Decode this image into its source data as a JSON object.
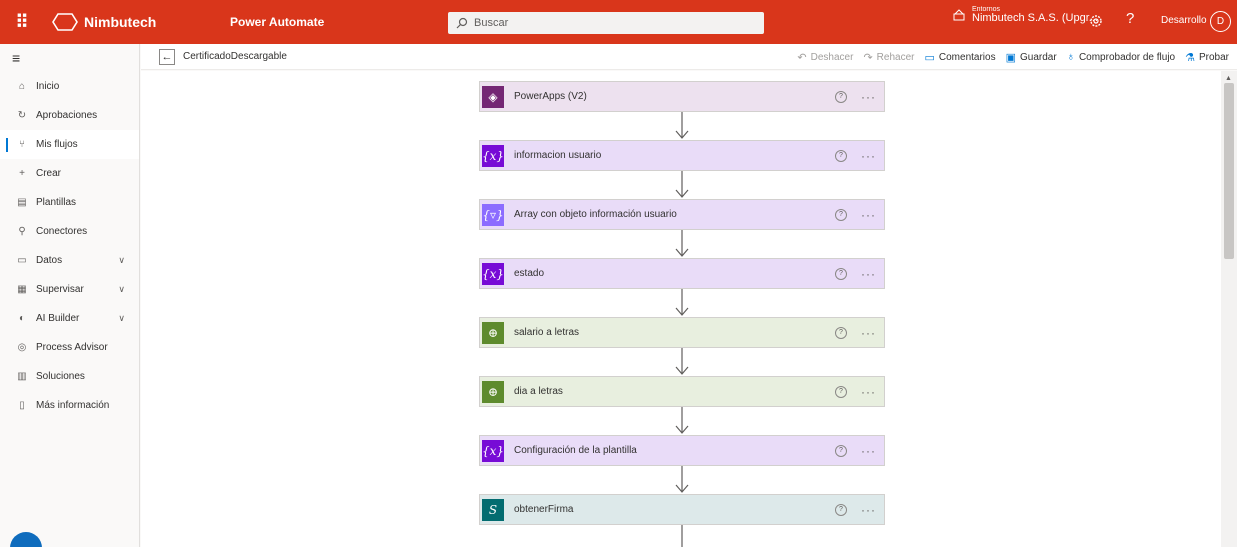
{
  "topbar": {
    "brand": "Nimbutech",
    "app": "Power Automate",
    "search_placeholder": "Buscar",
    "env_label": "Entornos",
    "env_name": "Nimbutech S.A.S. (Upgr...",
    "help": "?",
    "user": "Desarrollo",
    "avatar": "D"
  },
  "nav": {
    "items": [
      {
        "label": "Inicio",
        "icon": "home-icon"
      },
      {
        "label": "Aprobaciones",
        "icon": "approvals-icon"
      },
      {
        "label": "Mis flujos",
        "icon": "flows-icon",
        "active": true
      },
      {
        "label": "Crear",
        "icon": "plus-icon"
      },
      {
        "label": "Plantillas",
        "icon": "templates-icon"
      },
      {
        "label": "Conectores",
        "icon": "connectors-icon"
      },
      {
        "label": "Datos",
        "icon": "data-icon",
        "chevron": true
      },
      {
        "label": "Supervisar",
        "icon": "monitor-icon",
        "chevron": true
      },
      {
        "label": "AI Builder",
        "icon": "ai-builder-icon",
        "chevron": true
      },
      {
        "label": "Process Advisor",
        "icon": "process-advisor-icon"
      },
      {
        "label": "Soluciones",
        "icon": "solutions-icon"
      },
      {
        "label": "Más información",
        "icon": "book-icon"
      }
    ]
  },
  "cmdbar": {
    "flow_name": "CertificadoDescargable",
    "undo": "Deshacer",
    "redo": "Rehacer",
    "comments": "Comentarios",
    "save": "Guardar",
    "checker": "Comprobador de flujo",
    "test": "Probar"
  },
  "flow": {
    "steps": [
      {
        "title": "PowerApps (V2)",
        "icon": "powerapps-icon",
        "color": "#742774"
      },
      {
        "title": "informacion usuario",
        "icon": "variable-icon",
        "color": "#770bd6"
      },
      {
        "title": "Array con objeto información usuario",
        "icon": "data-operation-icon",
        "color": "#8c6cff"
      },
      {
        "title": "estado",
        "icon": "variable-icon",
        "color": "#770bd6"
      },
      {
        "title": "salario a letras",
        "icon": "connector-globe-icon",
        "color": "#5e8b2d"
      },
      {
        "title": "dia a letras",
        "icon": "connector-globe-icon",
        "color": "#5e8b2d"
      },
      {
        "title": "Configuración de la plantilla",
        "icon": "variable-icon",
        "color": "#770bd6"
      },
      {
        "title": "obtenerFirma",
        "icon": "sharepoint-icon",
        "color": "#036c70"
      }
    ],
    "help_glyph": "?",
    "more_glyph": "···"
  }
}
